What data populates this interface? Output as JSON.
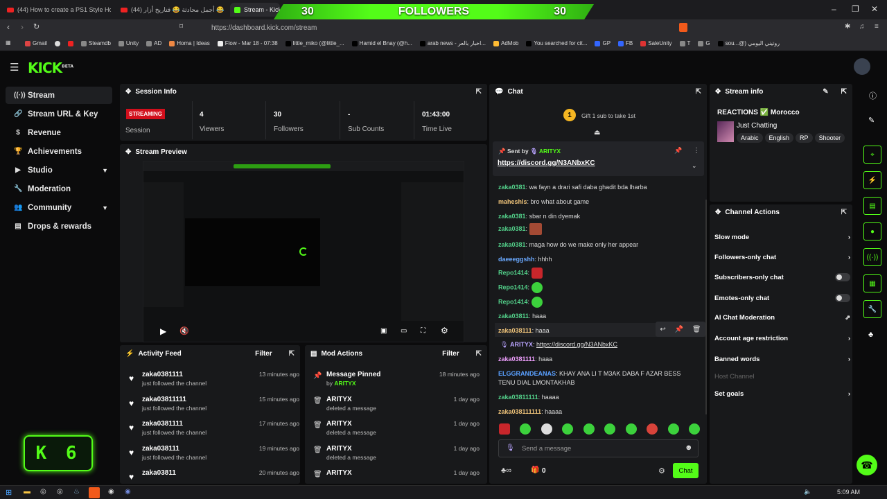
{
  "browser": {
    "tabs": [
      {
        "label": "(44) How to create a PS1 Style Horro"
      },
      {
        "label": "(44) أجمل محادثة 😂 فتاريخ أزار 😂 ... tube"
      },
      {
        "label": "Stream - Kick"
      }
    ],
    "url": "https://dashboard.kick.com/stream",
    "bookmarks": [
      "Gmail",
      "Steamdb",
      "Unity",
      "AD",
      "Homa | Ideas",
      "Flow - Mar 18 - 07:38",
      "little_miko (@little_...",
      "Hamid el Bnay (@h...",
      "arab news - اخبار بالعر...",
      "AdMob",
      "You searched for cit...",
      "GP",
      "FB",
      "SaleUnity",
      "T",
      "G",
      "sou...@) روتيني اليومي"
    ]
  },
  "overlay": {
    "left": "30",
    "title": "FOLLOWERS",
    "right": "30"
  },
  "header": {
    "logo": "KICK",
    "logo_sup": "BETA"
  },
  "sidebar": {
    "items": [
      {
        "label": "Stream",
        "icon": "stream-icon"
      },
      {
        "label": "Stream URL & Key",
        "icon": "link-icon"
      },
      {
        "label": "Revenue",
        "icon": "dollar-icon"
      },
      {
        "label": "Achievements",
        "icon": "trophy-icon"
      },
      {
        "label": "Studio",
        "icon": "video-icon"
      },
      {
        "label": "Moderation",
        "icon": "wrench-icon"
      },
      {
        "label": "Community",
        "icon": "users-icon"
      },
      {
        "label": "Drops & rewards",
        "icon": "drops-icon"
      }
    ]
  },
  "session": {
    "title": "Session Info",
    "badge": "STREAMING",
    "session_label": "Session",
    "stats": [
      {
        "value": "4",
        "label": "Viewers"
      },
      {
        "value": "30",
        "label": "Followers"
      },
      {
        "value": "-",
        "label": "Sub Counts"
      },
      {
        "value": "01:43:00",
        "label": "Time Live"
      }
    ]
  },
  "preview": {
    "title": "Stream Preview"
  },
  "activity": {
    "title": "Activity Feed",
    "filter": "Filter",
    "items": [
      {
        "name": "zaka0381111",
        "sub": "just followed the channel",
        "time": "13 minutes ago"
      },
      {
        "name": "zaka03811111",
        "sub": "just followed the channel",
        "time": "15 minutes ago"
      },
      {
        "name": "zaka0381111",
        "sub": "just followed the channel",
        "time": "17 minutes ago"
      },
      {
        "name": "zaka038111",
        "sub": "just followed the channel",
        "time": "19 minutes ago"
      },
      {
        "name": "zaka03811",
        "sub": "",
        "time": "20 minutes ago"
      }
    ]
  },
  "mod": {
    "title": "Mod Actions",
    "filter": "Filter",
    "items": [
      {
        "name": "Message Pinned",
        "sub": "by",
        "by": "ARITYX",
        "time": "18 minutes ago"
      },
      {
        "name": "ARITYX",
        "sub": "deleted a message",
        "time": "1 day ago"
      },
      {
        "name": "ARITYX",
        "sub": "deleted a message",
        "time": "1 day ago"
      },
      {
        "name": "ARITYX",
        "sub": "deleted a message",
        "time": "1 day ago"
      },
      {
        "name": "ARITYX",
        "sub": "",
        "time": "1 day ago"
      }
    ]
  },
  "chat": {
    "title": "Chat",
    "gift": "Gift 1 sub to take 1st",
    "gift_count": "1",
    "pinned": {
      "label": "Sent by",
      "user": "ARITYX",
      "link": "https://discord.gg/N3ANbxKC"
    },
    "messages": [
      {
        "user": "zaka0381",
        "color": "#53d18a",
        "text": "wa fayn a drari safi daba ghadit bda lharba"
      },
      {
        "user": "maheshls",
        "color": "#f0c47a",
        "text": "bro what about game"
      },
      {
        "user": "zaka0381",
        "color": "#53d18a",
        "text": "sbar n din dyemak"
      },
      {
        "user": "zaka0381",
        "color": "#53d18a",
        "text": ""
      },
      {
        "user": "zaka0381",
        "color": "#53d18a",
        "text": "maga how do we make only her appear"
      },
      {
        "user": "daeeeggshh",
        "color": "#6aa9ff",
        "text": "hhhh"
      },
      {
        "user": "Repo1414",
        "color": "#53d18a",
        "text": ""
      },
      {
        "user": "Repo1414",
        "color": "#53d18a",
        "text": ""
      },
      {
        "user": "Repo1414",
        "color": "#53d18a",
        "text": ""
      },
      {
        "user": "zaka03811",
        "color": "#53d18a",
        "text": "haaa"
      },
      {
        "user": "zaka038111",
        "color": "#f0c47a",
        "text": "haaa"
      },
      {
        "user": "ARITYX",
        "color": "#b9a4ff",
        "text": "https://discord.gg/N3ANbxKC"
      },
      {
        "user": "zaka0381111",
        "color": "#f0a0ff",
        "text": "haaa"
      },
      {
        "user": "ELGGRANDEANAS",
        "color": "#5aa0ff",
        "text": "KHAY ANA LI T M3AK DABA F AZAR BESS TENU DIAL LMONTAKHAB"
      },
      {
        "user": "zaka03811111",
        "color": "#53d18a",
        "text": "haaaa"
      },
      {
        "user": "zaka038111111",
        "color": "#f0c47a",
        "text": "haaaa"
      }
    ],
    "placeholder": "Send a message",
    "points": "0",
    "send": "Chat"
  },
  "streaminfo": {
    "title": "Stream info",
    "stream_title": "REACTIONS ✅ Morocco",
    "category": "Just Chatting",
    "tags": [
      "Arabic",
      "English",
      "RP",
      "Shooter"
    ]
  },
  "actions": {
    "title": "Channel Actions",
    "items": [
      {
        "label": "Slow mode",
        "kind": "chevron"
      },
      {
        "label": "Followers-only chat",
        "kind": "chevron"
      },
      {
        "label": "Subscribers-only chat",
        "kind": "toggle"
      },
      {
        "label": "Emotes-only chat",
        "kind": "toggle"
      },
      {
        "label": "AI Chat Moderation",
        "kind": "external"
      },
      {
        "label": "Account age restriction",
        "kind": "chevron"
      },
      {
        "label": "Banned words",
        "kind": "chevron"
      },
      {
        "label": "Host Channel",
        "kind": "disabled"
      },
      {
        "label": "Set goals",
        "kind": "chevron"
      }
    ]
  },
  "badge_overlay": {
    "text": "K 6"
  },
  "taskbar": {
    "time": "5:09 AM"
  }
}
